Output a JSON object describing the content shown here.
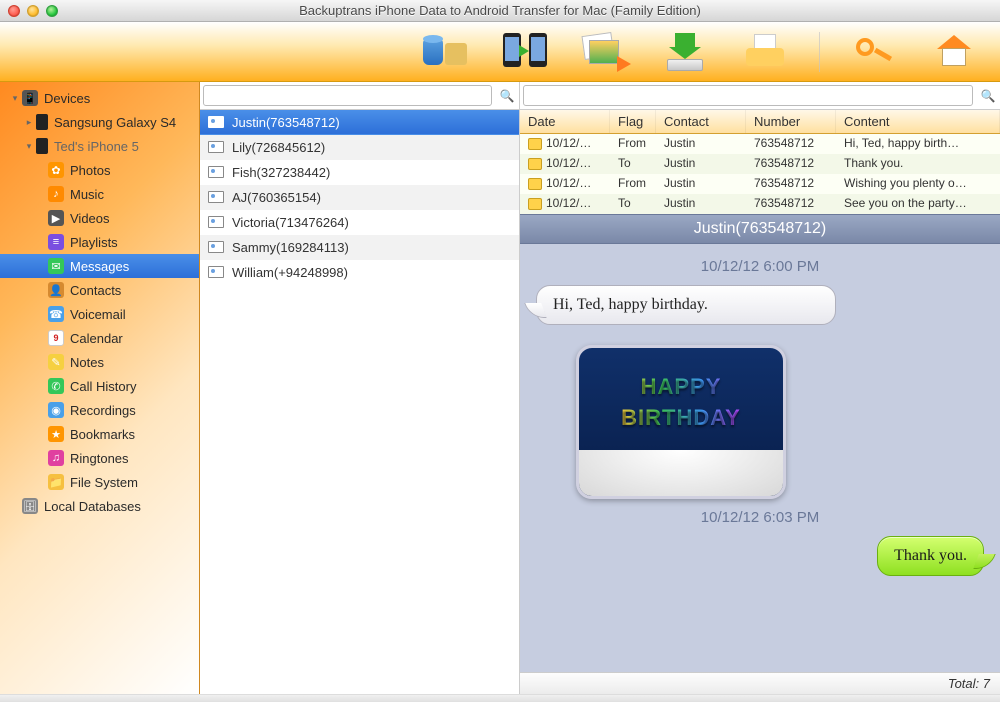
{
  "window": {
    "title": "Backuptrans iPhone Data to Android Transfer for Mac (Family Edition)"
  },
  "toolbar": {
    "backup": "backup",
    "phones": "transfer",
    "media": "media",
    "download": "download",
    "print": "print",
    "key": "register",
    "home": "home"
  },
  "sidebar": {
    "devices_label": "Devices",
    "devices": [
      {
        "name": "Sangsung Galaxy S4"
      },
      {
        "name": "Ted's iPhone 5",
        "expanded": true,
        "children": [
          {
            "k": "photos",
            "label": "Photos"
          },
          {
            "k": "music",
            "label": "Music"
          },
          {
            "k": "videos",
            "label": "Videos"
          },
          {
            "k": "playlists",
            "label": "Playlists"
          },
          {
            "k": "messages",
            "label": "Messages",
            "selected": true
          },
          {
            "k": "contacts",
            "label": "Contacts"
          },
          {
            "k": "voicemail",
            "label": "Voicemail"
          },
          {
            "k": "calendar",
            "label": "Calendar"
          },
          {
            "k": "notes",
            "label": "Notes"
          },
          {
            "k": "callhist",
            "label": "Call History"
          },
          {
            "k": "record",
            "label": "Recordings"
          },
          {
            "k": "bookmark",
            "label": "Bookmarks"
          },
          {
            "k": "ringtone",
            "label": "Ringtones"
          },
          {
            "k": "fs",
            "label": "File System"
          }
        ]
      }
    ],
    "localdb_label": "Local Databases"
  },
  "contact_search": {
    "value": ""
  },
  "contacts": [
    {
      "label": "Justin(763548712)",
      "selected": true
    },
    {
      "label": "Lily(726845612)"
    },
    {
      "label": "Fish(327238442)"
    },
    {
      "label": "AJ(760365154)"
    },
    {
      "label": "Victoria(713476264)"
    },
    {
      "label": "Sammy(169284113)"
    },
    {
      "label": "William(+94248998)"
    }
  ],
  "message_search": {
    "value": ""
  },
  "grid": {
    "headers": {
      "date": "Date",
      "flag": "Flag",
      "contact": "Contact",
      "number": "Number",
      "content": "Content"
    },
    "rows": [
      {
        "date": "10/12/…",
        "flag": "From",
        "contact": "Justin",
        "number": "763548712",
        "content": "Hi, Ted, happy birth…"
      },
      {
        "date": "10/12/…",
        "flag": "To",
        "contact": "Justin",
        "number": "763548712",
        "content": "Thank you."
      },
      {
        "date": "10/12/…",
        "flag": "From",
        "contact": "Justin",
        "number": "763548712",
        "content": "Wishing you plenty o…"
      },
      {
        "date": "10/12/…",
        "flag": "To",
        "contact": "Justin",
        "number": "763548712",
        "content": "See you on the party…"
      }
    ]
  },
  "conversation": {
    "title": "Justin(763548712)",
    "ts1": "10/12/12 6:00 PM",
    "msg1": "Hi, Ted, happy birthday.",
    "image_caption": "HAPPY BIRTHDAY",
    "ts2": "10/12/12 6:03 PM",
    "msg2": "Thank you."
  },
  "status": {
    "total_label": "Total: 7"
  }
}
